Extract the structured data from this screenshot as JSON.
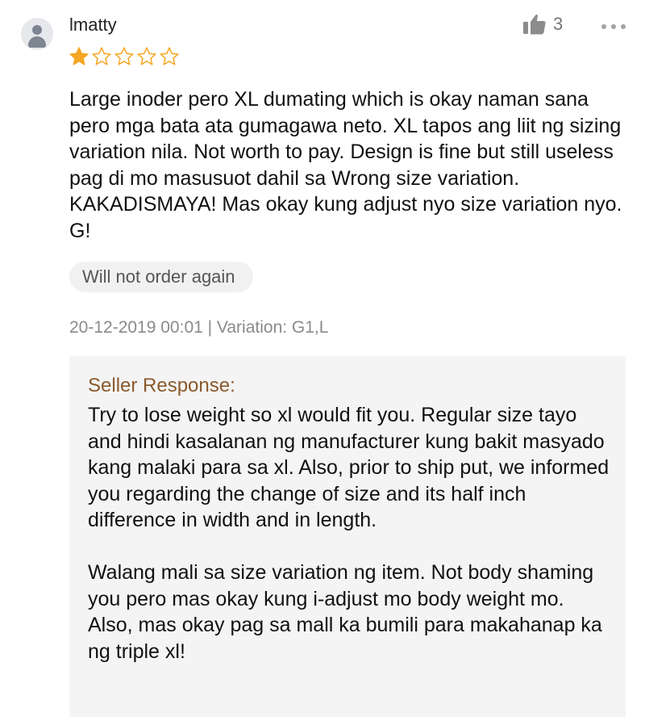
{
  "review": {
    "username": "lmatty",
    "rating": 1,
    "rating_max": 5,
    "likes": "3",
    "text": "Large inoder pero XL dumating which is okay naman sana pero mga bata ata gumagawa neto. XL tapos ang liit ng sizing variation nila. Not worth to pay. Design is fine but still useless pag di mo masusuot dahil sa Wrong size variation. KAKADISMAYA! Mas okay kung adjust nyo size variation nyo. G!",
    "tag": "Will not order again",
    "meta": "20-12-2019 00:01 | Variation: G1,L"
  },
  "seller_response": {
    "title": "Seller Response:",
    "paragraphs": [
      "Try to lose weight so xl would fit you. Regular size tayo and hindi kasalanan ng manufacturer kung bakit masyado kang malaki para sa xl. Also, prior to ship put, we informed you regarding the change of size and its half inch difference in width and in length.",
      "Walang mali sa size variation ng item. Not body shaming you pero mas okay kung i-adjust mo body weight mo. Also, mas okay pag sa mall ka bumili para makahanap ka ng triple xl!"
    ]
  },
  "icons": {
    "avatar": "user-avatar-icon",
    "like": "thumbs-up-icon",
    "more": "more-dots-icon",
    "star_filled": "star-filled-icon",
    "star_empty": "star-outline-icon"
  },
  "colors": {
    "star": "#f5a623",
    "seller_title": "#8a5a2b",
    "meta_text": "#8a8a8a",
    "response_bg": "#f4f4f4"
  }
}
